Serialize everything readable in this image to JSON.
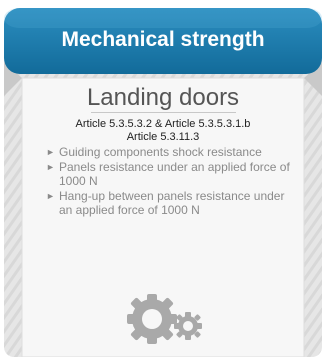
{
  "card": {
    "banner_label": "Mechanical strength",
    "title": "Landing doors",
    "reference_line_1": "Article 5.3.5.3.2 & Article 5.3.5.3.1.b",
    "reference_line_2": "Article 5.3.11.3",
    "marker": "►",
    "items": [
      {
        "text": "Guiding components shock resistance"
      },
      {
        "text": "Panels resistance under an applied force of 1000 N"
      },
      {
        "text": "Hang-up between panels resistance under an applied force of 1000 N"
      }
    ],
    "icon": "gears-icon"
  },
  "colors": {
    "banner": "#126b9a",
    "banner_light": "#2c8ec0",
    "panel": "#e4e4e4",
    "panel_stripe": "#d9d9d9",
    "paper": "#f7f7f7",
    "icon": "#a9a9a9"
  }
}
